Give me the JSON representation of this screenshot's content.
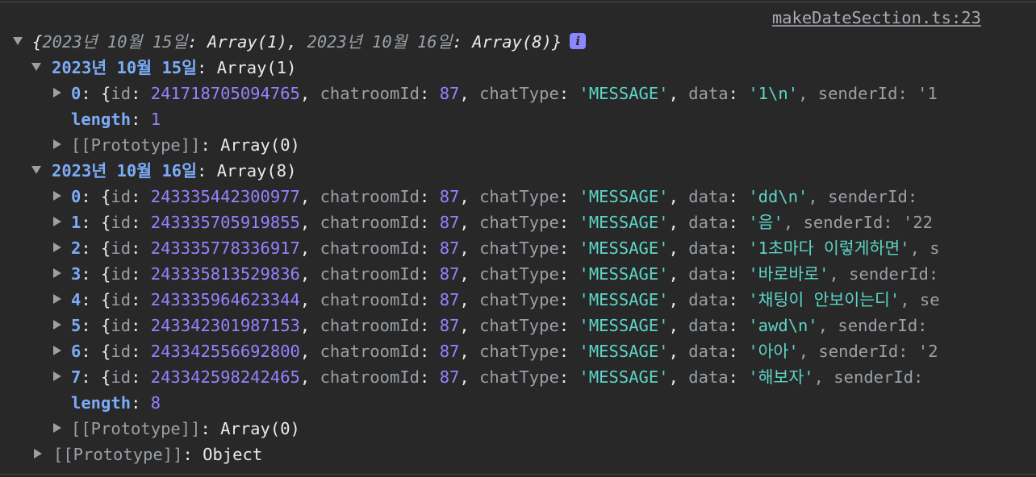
{
  "source_link": "makeDateSection.ts:23",
  "summary": {
    "open": "{",
    "key1": "2023년 10월 15일",
    "val1": "Array(1)",
    "key2": "2023년 10월 16일",
    "val2": "Array(8)",
    "close": "}",
    "info_label": "i"
  },
  "groups": [
    {
      "key": "2023년 10월 15일",
      "label": "Array(1)",
      "items": [
        {
          "index": "0",
          "id": "241718705094765",
          "chatroomId": "87",
          "chatType": "'MESSAGE'",
          "data": "'1\\n'",
          "tail": ", senderId: '1"
        }
      ],
      "length": "1"
    },
    {
      "key": "2023년 10월 16일",
      "label": "Array(8)",
      "items": [
        {
          "index": "0",
          "id": "243335442300977",
          "chatroomId": "87",
          "chatType": "'MESSAGE'",
          "data": "'dd\\n'",
          "tail": ", senderId: "
        },
        {
          "index": "1",
          "id": "243335705919855",
          "chatroomId": "87",
          "chatType": "'MESSAGE'",
          "data": "'음'",
          "tail": ", senderId: '22"
        },
        {
          "index": "2",
          "id": "243335778336917",
          "chatroomId": "87",
          "chatType": "'MESSAGE'",
          "data": "'1초마다 이렇게하면'",
          "tail": ", s"
        },
        {
          "index": "3",
          "id": "243335813529836",
          "chatroomId": "87",
          "chatType": "'MESSAGE'",
          "data": "'바로바로'",
          "tail": ", senderId:"
        },
        {
          "index": "4",
          "id": "243335964623344",
          "chatroomId": "87",
          "chatType": "'MESSAGE'",
          "data": "'채팅이 안보이는디'",
          "tail": ", se"
        },
        {
          "index": "5",
          "id": "243342301987153",
          "chatroomId": "87",
          "chatType": "'MESSAGE'",
          "data": "'awd\\n'",
          "tail": ", senderId:"
        },
        {
          "index": "6",
          "id": "243342556692800",
          "chatroomId": "87",
          "chatType": "'MESSAGE'",
          "data": "'아아'",
          "tail": ", senderId: '2"
        },
        {
          "index": "7",
          "id": "243342598242465",
          "chatroomId": "87",
          "chatType": "'MESSAGE'",
          "data": "'해보자'",
          "tail": ", senderId:"
        }
      ],
      "length": "8"
    }
  ],
  "labels": {
    "length": "length",
    "prototype": "[[Prototype]]",
    "array0": "Array(0)",
    "object": "Object",
    "id": "id",
    "chatroomId": "chatroomId",
    "chatType": "chatType",
    "data": "data"
  }
}
